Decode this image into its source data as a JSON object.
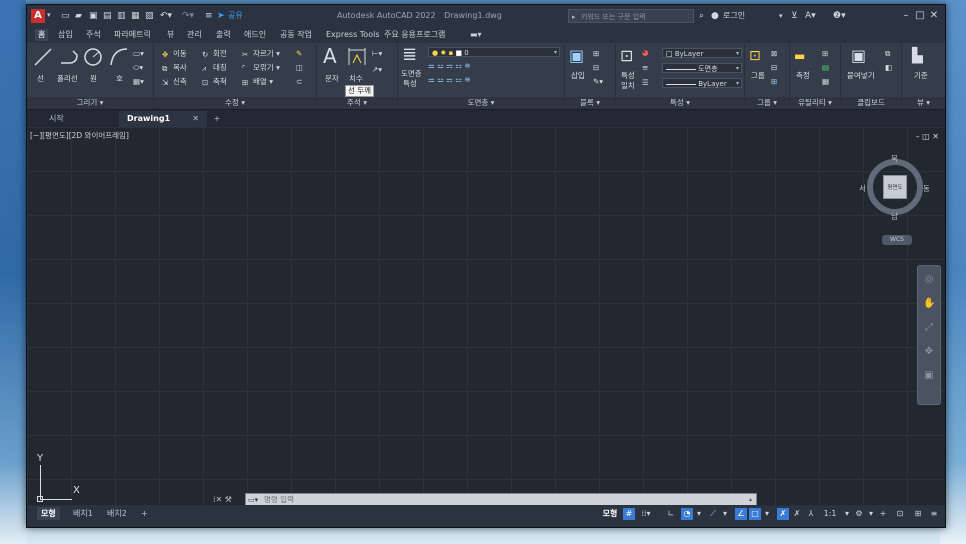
{
  "title": {
    "app": "Autodesk AutoCAD 2022",
    "file": "Drawing1.dwg"
  },
  "quick_access": {
    "share_label": "공유"
  },
  "search": {
    "placeholder": "키워드 또는 구문 입력"
  },
  "account": {
    "signin_label": "로그인"
  },
  "menu_tabs": [
    "홈",
    "삽입",
    "주석",
    "파라메트릭",
    "뷰",
    "관리",
    "출력",
    "애드인",
    "공동 작업",
    "Express Tools",
    "주요 응용프로그램"
  ],
  "ribbon": {
    "draw": {
      "title": "그리기 ▾",
      "line": "선",
      "polyline": "폴리선",
      "circle": "원",
      "arc": "호"
    },
    "modify": {
      "title": "수정 ▾",
      "move": "이동",
      "rotate": "회전",
      "trim": "자르기",
      "copy": "복사",
      "mirror": "대칭",
      "fillet": "모깎기",
      "stretch": "신축",
      "scale": "축척",
      "array": "배열"
    },
    "annotation": {
      "title": "주석 ▾",
      "text": "문자",
      "dimension": "치수",
      "tooltip": "선 두께"
    },
    "layers": {
      "title": "도면층 ▾",
      "properties_label_1": "도면층",
      "properties_label_2": "특성",
      "current_layer": "0"
    },
    "block": {
      "title": "블록 ▾",
      "insert": "삽입"
    },
    "properties": {
      "title": "특성 ▾",
      "match_1": "특성",
      "match_2": "일치",
      "color": "ByLayer",
      "lineweight": "도면층",
      "linetype": "ByLayer"
    },
    "groups": {
      "title": "그룹 ▾",
      "group": "그룹"
    },
    "utilities": {
      "title": "유틸리티 ▾",
      "measure": "측정"
    },
    "clipboard": {
      "title": "클립보드",
      "paste": "붙여넣기"
    },
    "view": {
      "title": "뷰 ▾",
      "base": "기준"
    }
  },
  "file_tabs": {
    "start": "시작",
    "drawing": "Drawing1"
  },
  "viewport": {
    "label": "[−][평면도][2D 와이어프레임]"
  },
  "viewcube": {
    "face": "평면도",
    "north": "북",
    "south": "남",
    "east": "동",
    "west": "서",
    "wcs": "WCS"
  },
  "ucs": {
    "x": "X",
    "y": "Y"
  },
  "command": {
    "placeholder": "명령 입력"
  },
  "layout_tabs": [
    "모형",
    "배치1",
    "배치2"
  ],
  "status": {
    "model": "모형",
    "scale": "1:1"
  }
}
